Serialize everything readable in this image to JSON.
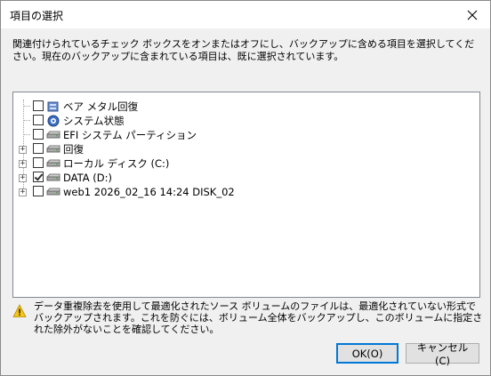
{
  "window": {
    "title": "項目の選択"
  },
  "description": "関連付けられているチェック ボックスをオンまたはオフにし、バックアップに含める項目を選択してください。現在のバックアップに含まれている項目は、既に選択されています。",
  "tree": {
    "items": [
      {
        "label": "ベア メタル回復",
        "checked": false,
        "expander": ""
      },
      {
        "label": "システム状態",
        "checked": false,
        "expander": ""
      },
      {
        "label": "EFI システム パーティション",
        "checked": false,
        "expander": ""
      },
      {
        "label": "回復",
        "checked": false,
        "expander": "+"
      },
      {
        "label": "ローカル ディスク (C:)",
        "checked": false,
        "expander": "+"
      },
      {
        "label": "DATA (D:)",
        "checked": true,
        "expander": "+"
      },
      {
        "label": "web1 2026_02_16 14:24 DISK_02",
        "checked": false,
        "expander": "+"
      }
    ]
  },
  "note": "データ重複除去を使用して最適化されたソース ボリュームのファイルは、最適化されていない形式でバックアップされます。これを防ぐには、ボリューム全体をバックアップし、このボリュームに指定された除外がないことを確認してください。",
  "buttons": {
    "ok": "OK(O)",
    "cancel": "キャンセル(C)"
  },
  "colors": {
    "accent": "#0078d7",
    "warning": "#f5c518"
  }
}
